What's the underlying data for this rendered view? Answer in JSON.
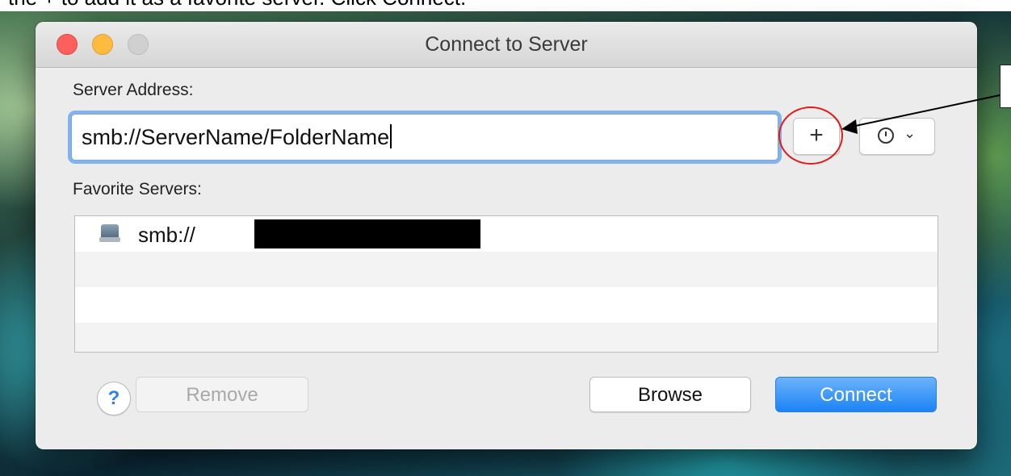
{
  "instruction_text": "the + to add it as a favorite server. Click Connect.",
  "window": {
    "title": "Connect to Server"
  },
  "server_address": {
    "label": "Server Address:",
    "value": "smb://ServerName/FolderName"
  },
  "add_button": {
    "label": "+"
  },
  "history_button": {
    "icon": "clock-icon",
    "chevron": "chevron-down-icon"
  },
  "favorites": {
    "label": "Favorite Servers:",
    "items": [
      {
        "text": "smb://",
        "icon": "server-icon",
        "redacted": true
      }
    ]
  },
  "footer": {
    "help_label": "?",
    "remove_label": "Remove",
    "browse_label": "Browse",
    "connect_label": "Connect"
  },
  "colors": {
    "connect_button": "#1b83f5",
    "focus_ring": "#60a0ec",
    "highlight_circle": "#e01b1b",
    "close_light": "#fc605c",
    "minimize_light": "#fdbc40"
  }
}
